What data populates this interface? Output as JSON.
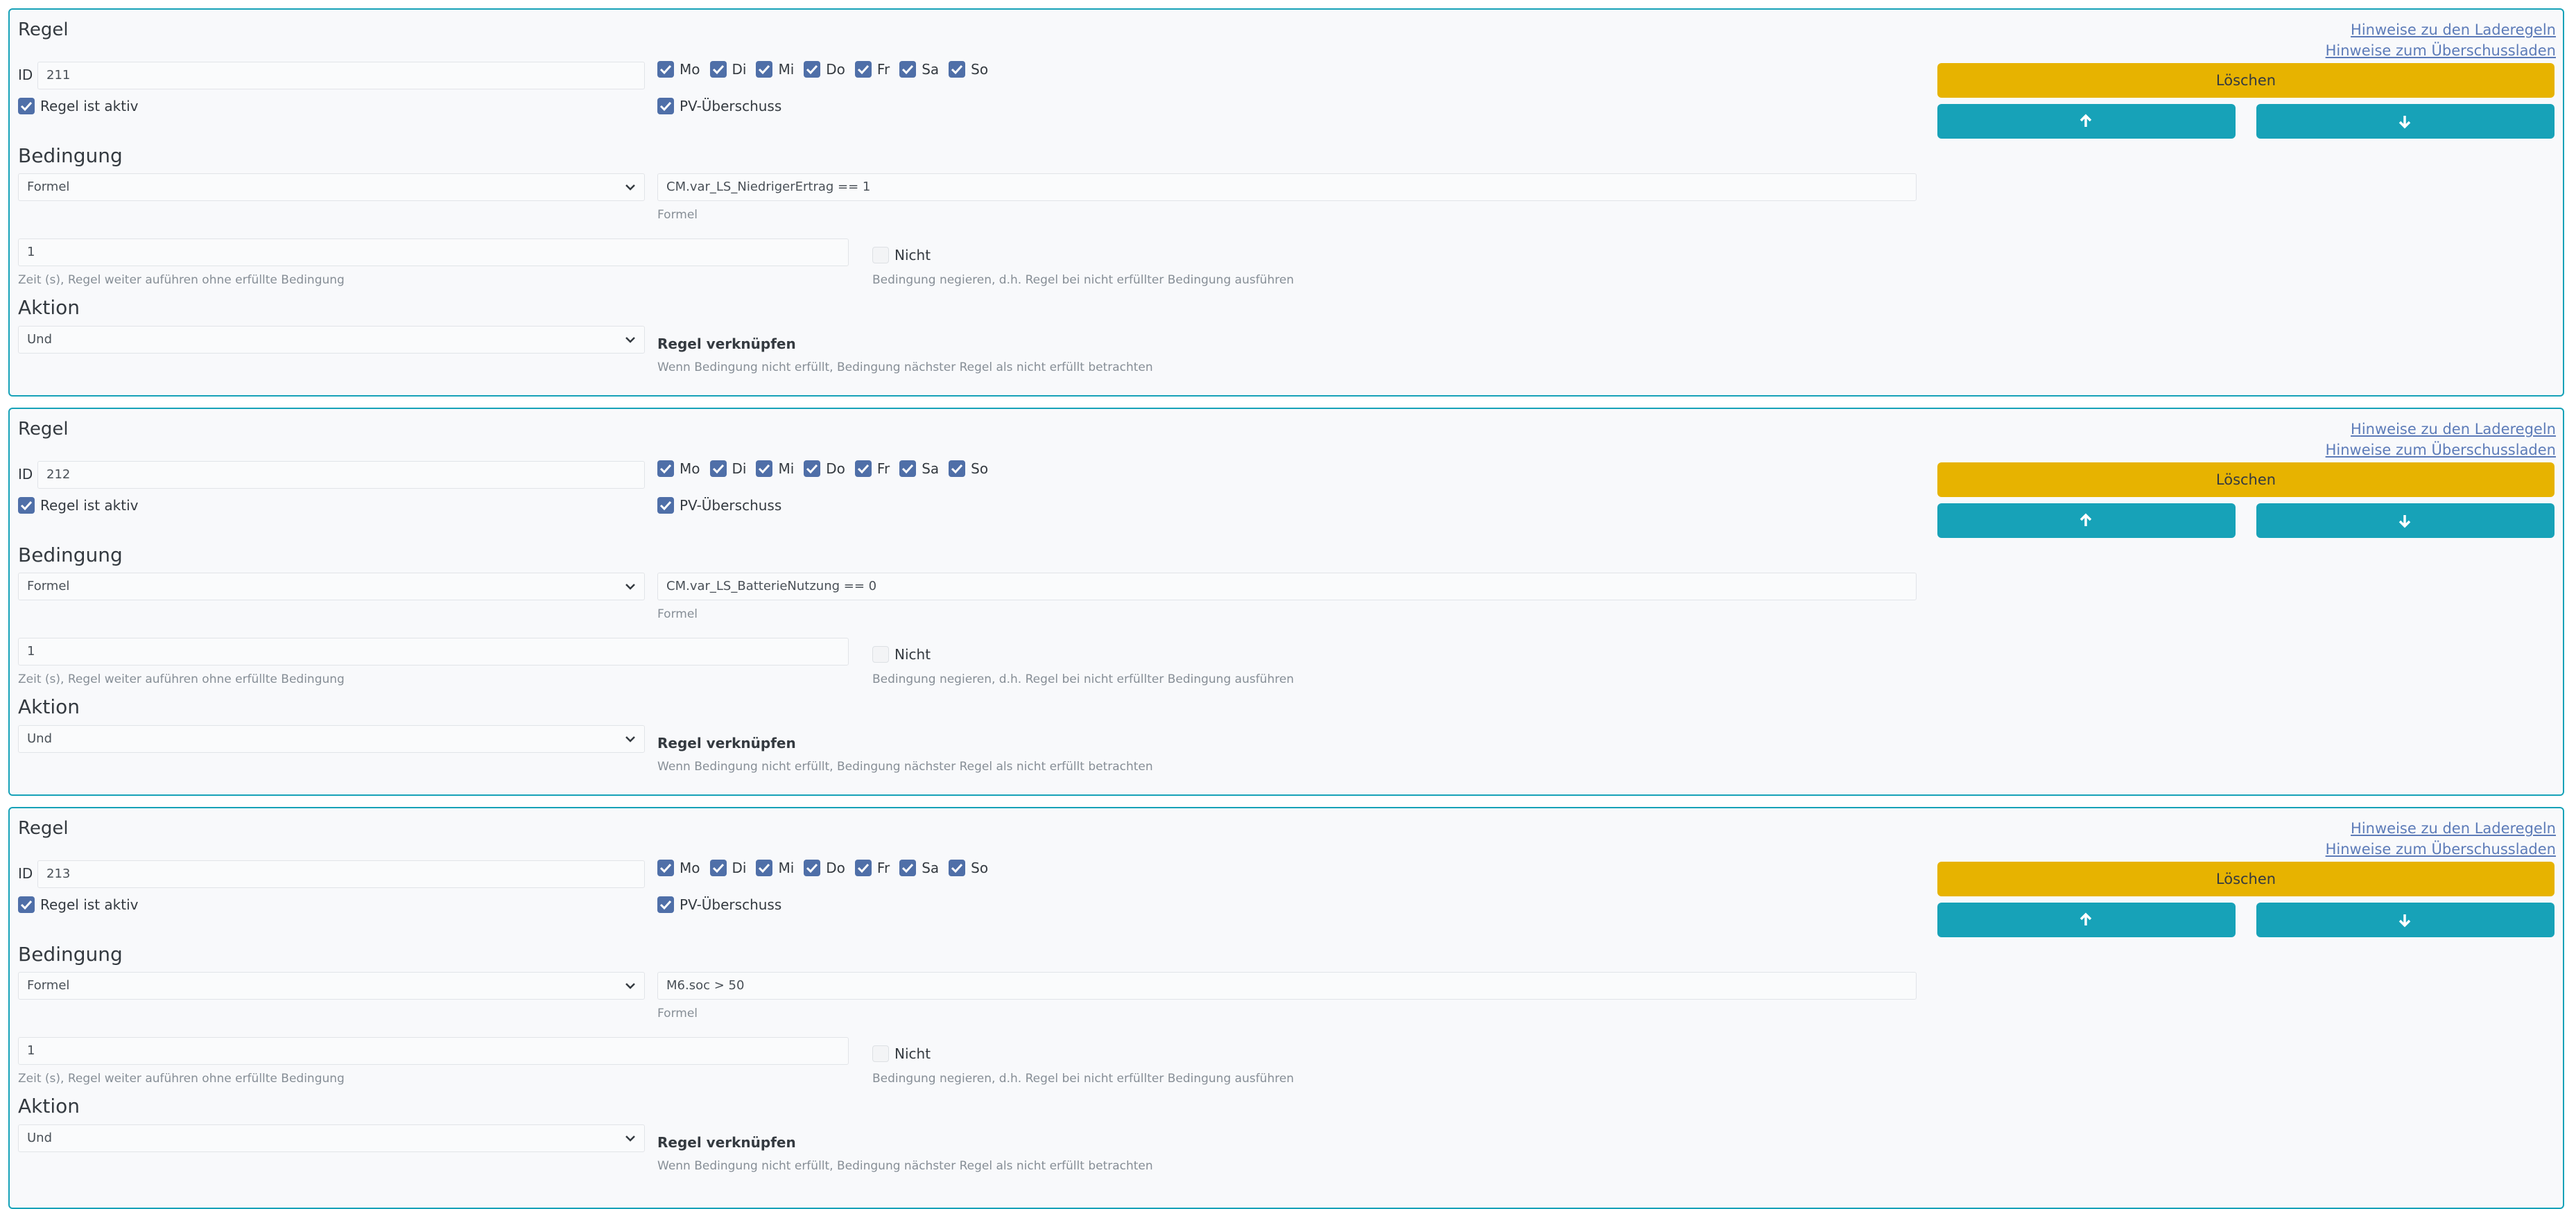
{
  "labels": {
    "rule_title": "Regel",
    "id_label": "ID",
    "active_label": "Regel ist aktiv",
    "pv_label": "PV-Überschuss",
    "condition_heading": "Bedingung",
    "action_heading": "Aktion",
    "formula_hint": "Formel",
    "delay_hint": "Zeit (s), Regel weiter auführen ohne erfüllte Bedingung",
    "negate_label": "Nicht",
    "negate_hint": "Bedingung negieren, d.h. Regel bei nicht erfüllter Bedingung ausführen",
    "link_label": "Regel verknüpfen",
    "link_hint": "Wenn Bedingung nicht erfüllt, Bedingung nächster Regel als nicht erfüllt betrachten",
    "delete_button": "Löschen",
    "help_link_charge_rules": "Hinweise zu den Laderegeln",
    "help_link_surplus": "Hinweise zum Überschussladen"
  },
  "days": [
    "Mo",
    "Di",
    "Mi",
    "Do",
    "Fr",
    "Sa",
    "So"
  ],
  "colors": {
    "accent": "#17a2b8",
    "delete": "#e7b300",
    "checkbox": "#4f6fa8"
  },
  "icons": {
    "up": "arrow-up-icon",
    "down": "arrow-down-icon",
    "select": "chevron-down-icon",
    "check": "check-icon"
  },
  "rules": [
    {
      "id": "211",
      "active": true,
      "pv_surplus": true,
      "days_checked": [
        true,
        true,
        true,
        true,
        true,
        true,
        true
      ],
      "condition_type": "Formel",
      "formula": "CM.var_LS_NiedrigerErtrag == 1",
      "delay": "1",
      "negate": false,
      "action": "Und"
    },
    {
      "id": "212",
      "active": true,
      "pv_surplus": true,
      "days_checked": [
        true,
        true,
        true,
        true,
        true,
        true,
        true
      ],
      "condition_type": "Formel",
      "formula": "CM.var_LS_BatterieNutzung == 0",
      "delay": "1",
      "negate": false,
      "action": "Und"
    },
    {
      "id": "213",
      "active": true,
      "pv_surplus": true,
      "days_checked": [
        true,
        true,
        true,
        true,
        true,
        true,
        true
      ],
      "condition_type": "Formel",
      "formula": "M6.soc > 50",
      "delay": "1",
      "negate": false,
      "action": "Und"
    }
  ]
}
